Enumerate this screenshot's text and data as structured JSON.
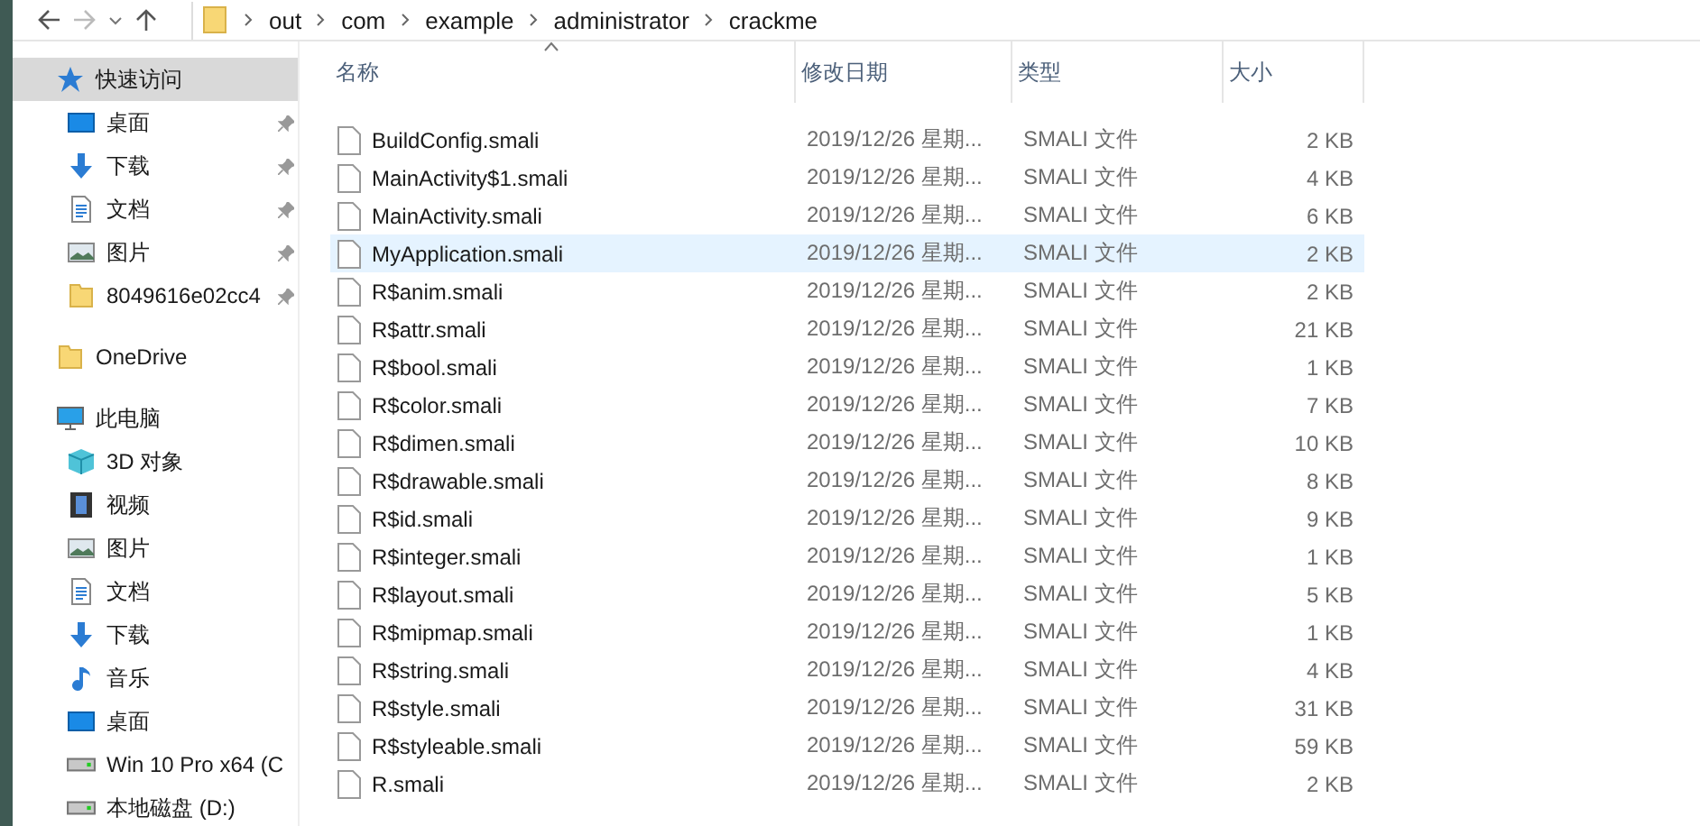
{
  "address_bar": {
    "segments": [
      "out",
      "com",
      "example",
      "administrator",
      "crackme"
    ]
  },
  "sidebar": {
    "items": [
      {
        "label": "快速访问",
        "selected": true,
        "children": [
          {
            "label": "桌面",
            "selected": false,
            "pinned": true
          },
          {
            "label": "下载",
            "selected": false,
            "pinned": true
          },
          {
            "label": "文档",
            "selected": false,
            "pinned": true
          },
          {
            "label": "图片",
            "selected": false,
            "pinned": true
          },
          {
            "label": "8049616e02cc4",
            "selected": false,
            "pinned": true
          }
        ]
      },
      {
        "label": "OneDrive",
        "selected": false
      },
      {
        "label": "此电脑",
        "selected": false,
        "children": [
          {
            "label": "3D 对象",
            "selected": false
          },
          {
            "label": "视频",
            "selected": false
          },
          {
            "label": "图片",
            "selected": false
          },
          {
            "label": "文档",
            "selected": false
          },
          {
            "label": "下载",
            "selected": false
          },
          {
            "label": "音乐",
            "selected": false
          },
          {
            "label": "桌面",
            "selected": false
          },
          {
            "label": "Win 10 Pro x64 (C",
            "selected": false
          },
          {
            "label": "本地磁盘 (D:)",
            "selected": false
          }
        ]
      }
    ]
  },
  "table": {
    "columns": [
      "名称",
      "修改日期",
      "类型",
      "大小"
    ],
    "rows": [
      {
        "name": "BuildConfig.smali",
        "date": "2019/12/26 星期...",
        "type": "SMALI 文件",
        "size": "2 KB",
        "selected": false
      },
      {
        "name": "MainActivity$1.smali",
        "date": "2019/12/26 星期...",
        "type": "SMALI 文件",
        "size": "4 KB",
        "selected": false
      },
      {
        "name": "MainActivity.smali",
        "date": "2019/12/26 星期...",
        "type": "SMALI 文件",
        "size": "6 KB",
        "selected": false
      },
      {
        "name": "MyApplication.smali",
        "date": "2019/12/26 星期...",
        "type": "SMALI 文件",
        "size": "2 KB",
        "selected": true
      },
      {
        "name": "R$anim.smali",
        "date": "2019/12/26 星期...",
        "type": "SMALI 文件",
        "size": "2 KB",
        "selected": false
      },
      {
        "name": "R$attr.smali",
        "date": "2019/12/26 星期...",
        "type": "SMALI 文件",
        "size": "21 KB",
        "selected": false
      },
      {
        "name": "R$bool.smali",
        "date": "2019/12/26 星期...",
        "type": "SMALI 文件",
        "size": "1 KB",
        "selected": false
      },
      {
        "name": "R$color.smali",
        "date": "2019/12/26 星期...",
        "type": "SMALI 文件",
        "size": "7 KB",
        "selected": false
      },
      {
        "name": "R$dimen.smali",
        "date": "2019/12/26 星期...",
        "type": "SMALI 文件",
        "size": "10 KB",
        "selected": false
      },
      {
        "name": "R$drawable.smali",
        "date": "2019/12/26 星期...",
        "type": "SMALI 文件",
        "size": "8 KB",
        "selected": false
      },
      {
        "name": "R$id.smali",
        "date": "2019/12/26 星期...",
        "type": "SMALI 文件",
        "size": "9 KB",
        "selected": false
      },
      {
        "name": "R$integer.smali",
        "date": "2019/12/26 星期...",
        "type": "SMALI 文件",
        "size": "1 KB",
        "selected": false
      },
      {
        "name": "R$layout.smali",
        "date": "2019/12/26 星期...",
        "type": "SMALI 文件",
        "size": "5 KB",
        "selected": false
      },
      {
        "name": "R$mipmap.smali",
        "date": "2019/12/26 星期...",
        "type": "SMALI 文件",
        "size": "1 KB",
        "selected": false
      },
      {
        "name": "R$string.smali",
        "date": "2019/12/26 星期...",
        "type": "SMALI 文件",
        "size": "4 KB",
        "selected": false
      },
      {
        "name": "R$style.smali",
        "date": "2019/12/26 星期...",
        "type": "SMALI 文件",
        "size": "31 KB",
        "selected": false
      },
      {
        "name": "R$styleable.smali",
        "date": "2019/12/26 星期...",
        "type": "SMALI 文件",
        "size": "59 KB",
        "selected": false
      },
      {
        "name": "R.smali",
        "date": "2019/12/26 星期...",
        "type": "SMALI 文件",
        "size": "2 KB",
        "selected": false
      }
    ]
  }
}
